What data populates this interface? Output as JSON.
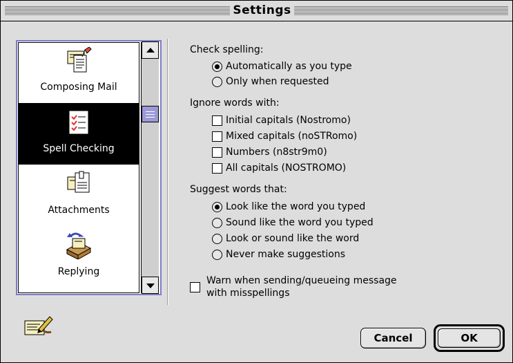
{
  "window": {
    "title": "Settings"
  },
  "sidebar": {
    "items": [
      {
        "label": "Composing Mail",
        "icon": "compose-mail-icon",
        "selected": false
      },
      {
        "label": "Spell Checking",
        "icon": "spell-check-icon",
        "selected": true
      },
      {
        "label": "Attachments",
        "icon": "attachments-icon",
        "selected": false
      },
      {
        "label": "Replying",
        "icon": "replying-icon",
        "selected": false
      }
    ]
  },
  "check_spelling": {
    "heading": "Check spelling:",
    "options": [
      {
        "label": "Automatically as you type",
        "checked": true
      },
      {
        "label": "Only when requested",
        "checked": false
      }
    ]
  },
  "ignore_words": {
    "heading": "Ignore words with:",
    "options": [
      {
        "label": "Initial capitals (Nostromo)",
        "checked": false
      },
      {
        "label": "Mixed capitals (noSTRomo)",
        "checked": false
      },
      {
        "label": "Numbers (n8str9m0)",
        "checked": false
      },
      {
        "label": "All capitals (NOSTROMO)",
        "checked": false
      }
    ]
  },
  "suggest_words": {
    "heading": "Suggest words that:",
    "options": [
      {
        "label": "Look like the word you typed",
        "checked": true
      },
      {
        "label": "Sound like the word you typed",
        "checked": false
      },
      {
        "label": "Look or sound like the word",
        "checked": false
      },
      {
        "label": "Never make suggestions",
        "checked": false
      }
    ]
  },
  "warn": {
    "line1": "Warn when sending/queueing message",
    "line2": "with misspellings",
    "checked": false
  },
  "buttons": {
    "cancel": "Cancel",
    "ok": "OK"
  },
  "colors": {
    "selection": "#000000",
    "accent": "#7e7cc4",
    "thumb": "#9b99d6",
    "window_bg": "#dddddd"
  }
}
